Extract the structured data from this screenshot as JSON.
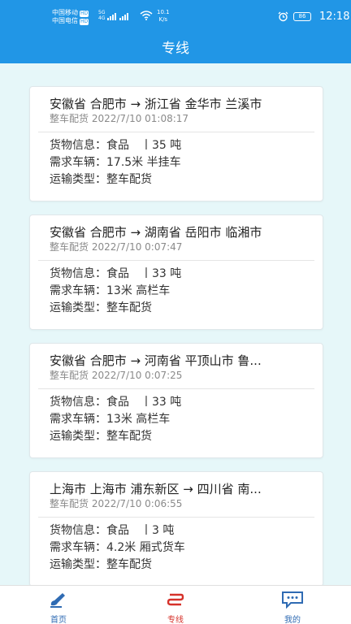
{
  "status": {
    "carrier1": "中国移动",
    "carrier2": "中国电信",
    "hd": "HD",
    "net_5g": "5G",
    "net_4g": "4G",
    "speed_value": "10.1",
    "speed_unit": "K/s",
    "battery": "86",
    "time": "12:18"
  },
  "header": {
    "title": "专线"
  },
  "labels": {
    "cargo": "货物信息：",
    "vehicle": "需求车辆：",
    "transport": "运输类型："
  },
  "cards": [
    {
      "route": "安徽省 合肥市 → 浙江省 金华市 兰溪市",
      "subtitle": "整车配货 2022/7/10 01:08:17",
      "cargo": "食品　丨35 吨",
      "vehicle": "17.5米 半挂车",
      "transport": "整车配货"
    },
    {
      "route": "安徽省 合肥市 → 湖南省 岳阳市 临湘市",
      "subtitle": "整车配货 2022/7/10 0:07:47",
      "cargo": "食品　丨33 吨",
      "vehicle": "13米 高栏车",
      "transport": "整车配货"
    },
    {
      "route": "安徽省 合肥市 → 河南省 平顶山市 鲁...",
      "subtitle": "整车配货 2022/7/10 0:07:25",
      "cargo": "食品　丨33 吨",
      "vehicle": "13米 高栏车",
      "transport": "整车配货"
    },
    {
      "route": "上海市 上海市 浦东新区 → 四川省 南...",
      "subtitle": "整车配货 2022/7/10 0:06:55",
      "cargo": "食品　丨3 吨",
      "vehicle": "4.2米 厢式货车",
      "transport": "整车配货"
    }
  ],
  "tabs": [
    {
      "label": "首页",
      "icon": "home-pen-icon",
      "color": "#2f6bb3"
    },
    {
      "label": "专线",
      "icon": "route-icon",
      "color": "#d6322b"
    },
    {
      "label": "我的",
      "icon": "chat-bubble-icon",
      "color": "#2f6bb3"
    }
  ],
  "colors": {
    "primary": "#2196e6",
    "background": "#e6f7f9",
    "active_tab": "#d6322b"
  }
}
